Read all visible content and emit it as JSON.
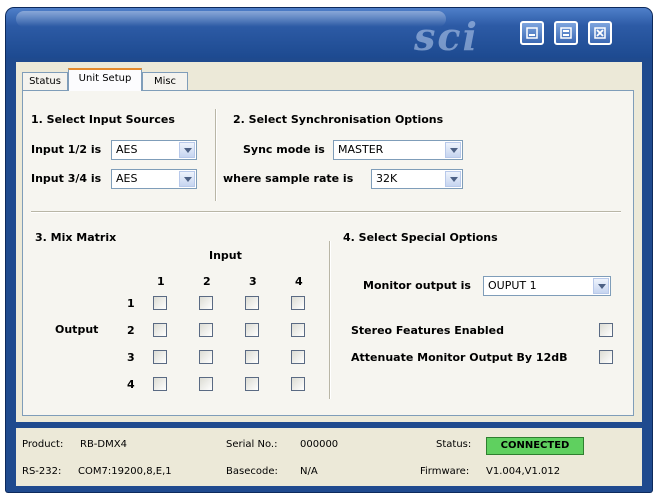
{
  "window": {
    "logo_text": "sci",
    "controls": [
      "minimize",
      "restore",
      "close"
    ]
  },
  "tabs": [
    {
      "label": "Status"
    },
    {
      "label": "Unit Setup",
      "active": true
    },
    {
      "label": "Misc"
    }
  ],
  "section1": {
    "title": "1. Select Input Sources",
    "input12_label": "Input 1/2 is",
    "input12_value": "AES",
    "input34_label": "Input 3/4 is",
    "input34_value": "AES"
  },
  "section2": {
    "title": "2. Select Synchronisation Options",
    "sync_label": "Sync mode is",
    "sync_value": "MASTER",
    "rate_label": "where sample rate is",
    "rate_value": "32K"
  },
  "section3": {
    "title": "3. Mix Matrix",
    "input_label": "Input",
    "output_label": "Output",
    "columns": [
      "1",
      "2",
      "3",
      "4"
    ],
    "rows": [
      "1",
      "2",
      "3",
      "4"
    ]
  },
  "section4": {
    "title": "4. Select Special Options",
    "monitor_label": "Monitor output is",
    "monitor_value": "OUPUT 1",
    "stereo_label": "Stereo Features Enabled",
    "attenuate_label": "Attenuate Monitor Output By 12dB"
  },
  "status": {
    "product_label": "Product:",
    "product_value": "RB-DMX4",
    "serial_label": "Serial No.:",
    "serial_value": "000000",
    "status_label": "Status:",
    "status_value": "CONNECTED",
    "rs232_label": "RS-232:",
    "rs232_value": "COM7:19200,8,E,1",
    "basecode_label": "Basecode:",
    "basecode_value": "N/A",
    "firmware_label": "Firmware:",
    "firmware_value": "V1.004,V1.012"
  },
  "colors": {
    "titlebar": "#2d5ba6",
    "panel": "#ece9d8",
    "connected": "#5fd05f"
  }
}
